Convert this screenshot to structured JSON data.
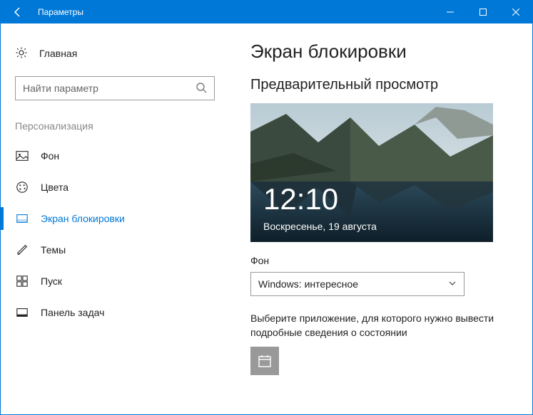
{
  "titlebar": {
    "title": "Параметры"
  },
  "sidebar": {
    "home": "Главная",
    "search_placeholder": "Найти параметр",
    "section": "Персонализация",
    "items": [
      {
        "label": "Фон"
      },
      {
        "label": "Цвета"
      },
      {
        "label": "Экран блокировки"
      },
      {
        "label": "Темы"
      },
      {
        "label": "Пуск"
      },
      {
        "label": "Панель задач"
      }
    ]
  },
  "main": {
    "title": "Экран блокировки",
    "preview_heading": "Предварительный просмотр",
    "preview_time": "12:10",
    "preview_date": "Воскресенье, 19 августа",
    "bg_label": "Фон",
    "bg_selected": "Windows: интересное",
    "app_hint": "Выберите приложение, для которого нужно вывести подробные сведения о состоянии"
  }
}
